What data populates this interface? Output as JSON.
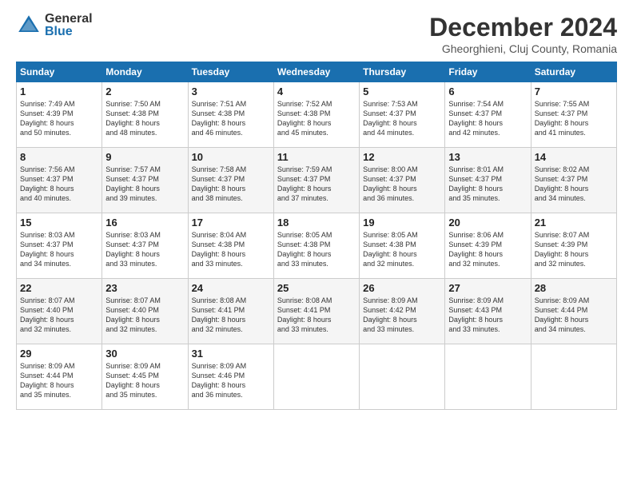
{
  "header": {
    "logo_general": "General",
    "logo_blue": "Blue",
    "title": "December 2024",
    "location": "Gheorghieni, Cluj County, Romania"
  },
  "calendar": {
    "headers": [
      "Sunday",
      "Monday",
      "Tuesday",
      "Wednesday",
      "Thursday",
      "Friday",
      "Saturday"
    ],
    "rows": [
      [
        {
          "day": "1",
          "info": "Sunrise: 7:49 AM\nSunset: 4:39 PM\nDaylight: 8 hours\nand 50 minutes."
        },
        {
          "day": "2",
          "info": "Sunrise: 7:50 AM\nSunset: 4:38 PM\nDaylight: 8 hours\nand 48 minutes."
        },
        {
          "day": "3",
          "info": "Sunrise: 7:51 AM\nSunset: 4:38 PM\nDaylight: 8 hours\nand 46 minutes."
        },
        {
          "day": "4",
          "info": "Sunrise: 7:52 AM\nSunset: 4:38 PM\nDaylight: 8 hours\nand 45 minutes."
        },
        {
          "day": "5",
          "info": "Sunrise: 7:53 AM\nSunset: 4:37 PM\nDaylight: 8 hours\nand 44 minutes."
        },
        {
          "day": "6",
          "info": "Sunrise: 7:54 AM\nSunset: 4:37 PM\nDaylight: 8 hours\nand 42 minutes."
        },
        {
          "day": "7",
          "info": "Sunrise: 7:55 AM\nSunset: 4:37 PM\nDaylight: 8 hours\nand 41 minutes."
        }
      ],
      [
        {
          "day": "8",
          "info": "Sunrise: 7:56 AM\nSunset: 4:37 PM\nDaylight: 8 hours\nand 40 minutes."
        },
        {
          "day": "9",
          "info": "Sunrise: 7:57 AM\nSunset: 4:37 PM\nDaylight: 8 hours\nand 39 minutes."
        },
        {
          "day": "10",
          "info": "Sunrise: 7:58 AM\nSunset: 4:37 PM\nDaylight: 8 hours\nand 38 minutes."
        },
        {
          "day": "11",
          "info": "Sunrise: 7:59 AM\nSunset: 4:37 PM\nDaylight: 8 hours\nand 37 minutes."
        },
        {
          "day": "12",
          "info": "Sunrise: 8:00 AM\nSunset: 4:37 PM\nDaylight: 8 hours\nand 36 minutes."
        },
        {
          "day": "13",
          "info": "Sunrise: 8:01 AM\nSunset: 4:37 PM\nDaylight: 8 hours\nand 35 minutes."
        },
        {
          "day": "14",
          "info": "Sunrise: 8:02 AM\nSunset: 4:37 PM\nDaylight: 8 hours\nand 34 minutes."
        }
      ],
      [
        {
          "day": "15",
          "info": "Sunrise: 8:03 AM\nSunset: 4:37 PM\nDaylight: 8 hours\nand 34 minutes."
        },
        {
          "day": "16",
          "info": "Sunrise: 8:03 AM\nSunset: 4:37 PM\nDaylight: 8 hours\nand 33 minutes."
        },
        {
          "day": "17",
          "info": "Sunrise: 8:04 AM\nSunset: 4:38 PM\nDaylight: 8 hours\nand 33 minutes."
        },
        {
          "day": "18",
          "info": "Sunrise: 8:05 AM\nSunset: 4:38 PM\nDaylight: 8 hours\nand 33 minutes."
        },
        {
          "day": "19",
          "info": "Sunrise: 8:05 AM\nSunset: 4:38 PM\nDaylight: 8 hours\nand 32 minutes."
        },
        {
          "day": "20",
          "info": "Sunrise: 8:06 AM\nSunset: 4:39 PM\nDaylight: 8 hours\nand 32 minutes."
        },
        {
          "day": "21",
          "info": "Sunrise: 8:07 AM\nSunset: 4:39 PM\nDaylight: 8 hours\nand 32 minutes."
        }
      ],
      [
        {
          "day": "22",
          "info": "Sunrise: 8:07 AM\nSunset: 4:40 PM\nDaylight: 8 hours\nand 32 minutes."
        },
        {
          "day": "23",
          "info": "Sunrise: 8:07 AM\nSunset: 4:40 PM\nDaylight: 8 hours\nand 32 minutes."
        },
        {
          "day": "24",
          "info": "Sunrise: 8:08 AM\nSunset: 4:41 PM\nDaylight: 8 hours\nand 32 minutes."
        },
        {
          "day": "25",
          "info": "Sunrise: 8:08 AM\nSunset: 4:41 PM\nDaylight: 8 hours\nand 33 minutes."
        },
        {
          "day": "26",
          "info": "Sunrise: 8:09 AM\nSunset: 4:42 PM\nDaylight: 8 hours\nand 33 minutes."
        },
        {
          "day": "27",
          "info": "Sunrise: 8:09 AM\nSunset: 4:43 PM\nDaylight: 8 hours\nand 33 minutes."
        },
        {
          "day": "28",
          "info": "Sunrise: 8:09 AM\nSunset: 4:44 PM\nDaylight: 8 hours\nand 34 minutes."
        }
      ],
      [
        {
          "day": "29",
          "info": "Sunrise: 8:09 AM\nSunset: 4:44 PM\nDaylight: 8 hours\nand 35 minutes."
        },
        {
          "day": "30",
          "info": "Sunrise: 8:09 AM\nSunset: 4:45 PM\nDaylight: 8 hours\nand 35 minutes."
        },
        {
          "day": "31",
          "info": "Sunrise: 8:09 AM\nSunset: 4:46 PM\nDaylight: 8 hours\nand 36 minutes."
        },
        {
          "day": "",
          "info": ""
        },
        {
          "day": "",
          "info": ""
        },
        {
          "day": "",
          "info": ""
        },
        {
          "day": "",
          "info": ""
        }
      ]
    ]
  }
}
